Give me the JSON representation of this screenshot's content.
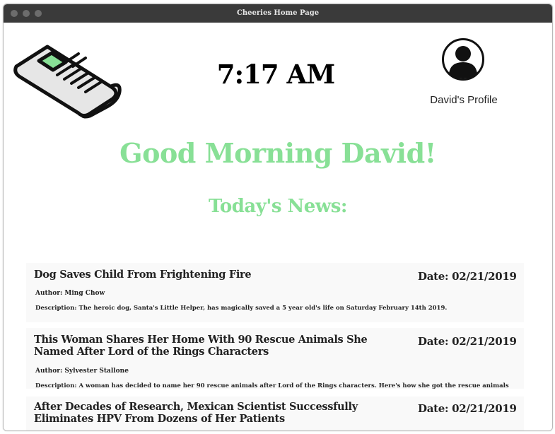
{
  "window": {
    "title": "Cheeries Home Page"
  },
  "header": {
    "logo_icon": "newspaper-icon",
    "time": "7:17 AM",
    "profile": {
      "icon": "user-avatar-icon",
      "label": "David's Profile"
    }
  },
  "greeting": "Good Morning David!",
  "news_heading": "Today's News:",
  "colors": {
    "accent": "#88e096",
    "titlebar": "#3a3a3a",
    "card_bg": "#f9f9f9"
  },
  "news": [
    {
      "headline": "Dog Saves Child From Frightening Fire",
      "date": "Date: 02/21/2019",
      "author": "Author: Ming Chow",
      "description": "Description: The heroic dog, Santa's Little Helper, has magically saved a 5 year old's life on Saturday February 14th 2019."
    },
    {
      "headline": "This Woman Shares Her Home With 90 Rescue Animals She Named After Lord of the Rings Characters",
      "date": "Date: 02/21/2019",
      "author": "Author: Sylvester Stallone",
      "description": "Description: A woman has decided to name her 90 rescue animals after Lord of the Rings characters. Here's how she got the rescue animals and"
    },
    {
      "headline": "After Decades of Research, Mexican Scientist Successfully Eliminates HPV From Dozens of Her Patients",
      "date": "Date: 02/21/2019"
    }
  ]
}
